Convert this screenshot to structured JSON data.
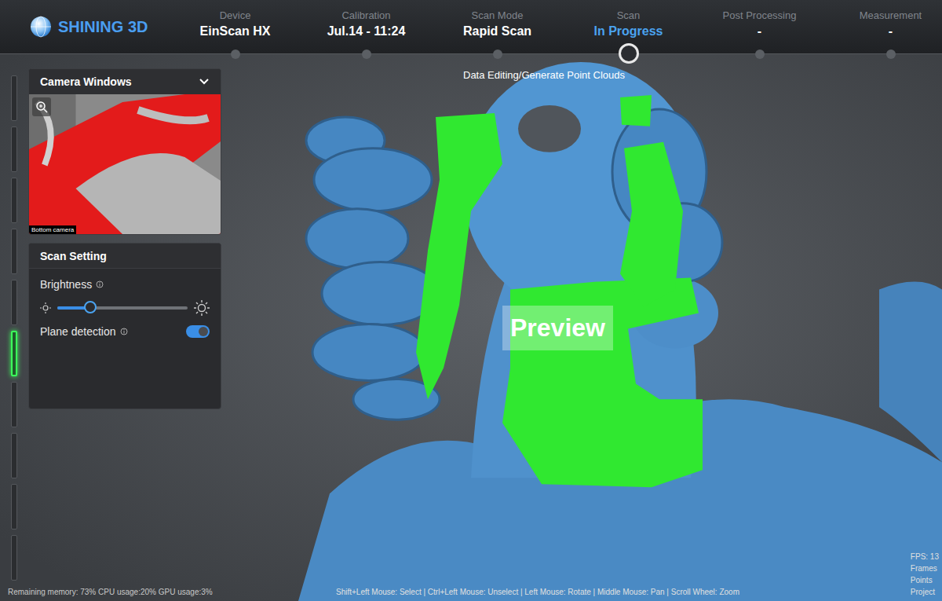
{
  "app": {
    "logo": "SHINING 3D"
  },
  "steps": [
    {
      "label": "Device",
      "value": "EinScan HX",
      "selected": false
    },
    {
      "label": "Calibration",
      "value": "Jul.14 - 11:24",
      "selected": false
    },
    {
      "label": "Scan Mode",
      "value": "Rapid Scan",
      "selected": false
    },
    {
      "label": "Scan",
      "value": "In Progress",
      "selected": true
    },
    {
      "label": "Post Processing",
      "value": "-",
      "selected": false
    },
    {
      "label": "Measurement",
      "value": "-",
      "selected": false
    }
  ],
  "subtitle": "Data Editing/Generate Point Clouds",
  "toolbar": [
    {
      "selected": false
    },
    {
      "selected": false
    },
    {
      "selected": false
    },
    {
      "selected": false
    },
    {
      "selected": false
    },
    {
      "selected": true
    },
    {
      "selected": false
    },
    {
      "selected": false
    },
    {
      "selected": false
    },
    {
      "selected": false
    }
  ],
  "camera_panel": {
    "title": "Camera Windows",
    "expanded": true,
    "camera_label": "Bottom camera"
  },
  "scan_setting": {
    "title": "Scan Setting",
    "brightness": {
      "label": "Brightness",
      "level": 0.25
    },
    "plane_detection": {
      "label": "Plane detection",
      "on": true
    }
  },
  "viewport": {
    "overlay": "Preview"
  },
  "status_bar": {
    "resources": "Remaining memory: 73% CPU usage:20% GPU usage:3%",
    "hints": "Shift+Left Mouse: Select | Ctrl+Left Mouse: Unselect | Left Mouse: Rotate | Middle Mouse: Pan | Scroll Wheel: Zoom",
    "stats": [
      "FPS: 13",
      "Frames",
      "Points",
      "Project"
    ]
  }
}
